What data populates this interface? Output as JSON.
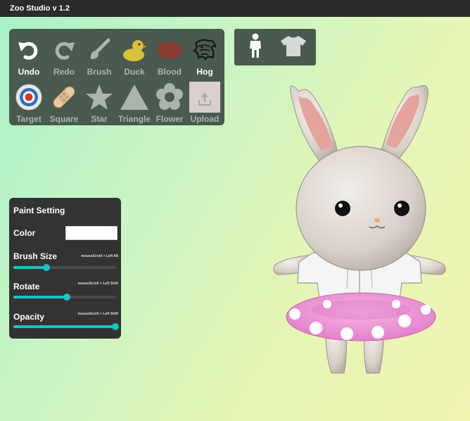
{
  "app": {
    "title": "Zoo Studio v 1.2"
  },
  "toolbar": {
    "row1": [
      {
        "label": "Undo",
        "icon": "undo-icon",
        "active": true
      },
      {
        "label": "Redo",
        "icon": "redo-icon",
        "active": false
      },
      {
        "label": "Brush",
        "icon": "brush-icon",
        "active": false
      },
      {
        "label": "Duck",
        "icon": "duck-icon",
        "active": false
      },
      {
        "label": "Blood",
        "icon": "blood-splat-icon",
        "active": false
      },
      {
        "label": "Hog",
        "icon": "hog-icon",
        "active": true
      }
    ],
    "row2": [
      {
        "label": "Target",
        "icon": "target-icon",
        "active": false
      },
      {
        "label": "Square",
        "icon": "bandage-icon",
        "active": false
      },
      {
        "label": "Star",
        "icon": "star-icon",
        "active": false
      },
      {
        "label": "Triangle",
        "icon": "triangle-icon",
        "active": false
      },
      {
        "label": "Flower",
        "icon": "flower-icon",
        "active": false
      },
      {
        "label": "Upload",
        "icon": "upload-icon",
        "active": false
      }
    ]
  },
  "view_tabs": [
    {
      "icon": "person-icon"
    },
    {
      "icon": "shirt-icon"
    }
  ],
  "paint_setting": {
    "title": "Paint Setting",
    "color": {
      "label": "Color",
      "value": "#ffffff"
    },
    "brush_size": {
      "label": "Brush Size",
      "hint": "mouseScroll + Left Alt",
      "value": 0.32
    },
    "rotate": {
      "label": "Rotate",
      "hint": "mouseScroll + Left Shift",
      "value": 0.52
    },
    "opacity": {
      "label": "Opacity",
      "hint": "mouseScroll + Left Shift",
      "value": 0.99
    }
  },
  "colors": {
    "accent": "#19c4c4",
    "panel": "#4a5a4f",
    "panel_dark": "#333333"
  }
}
